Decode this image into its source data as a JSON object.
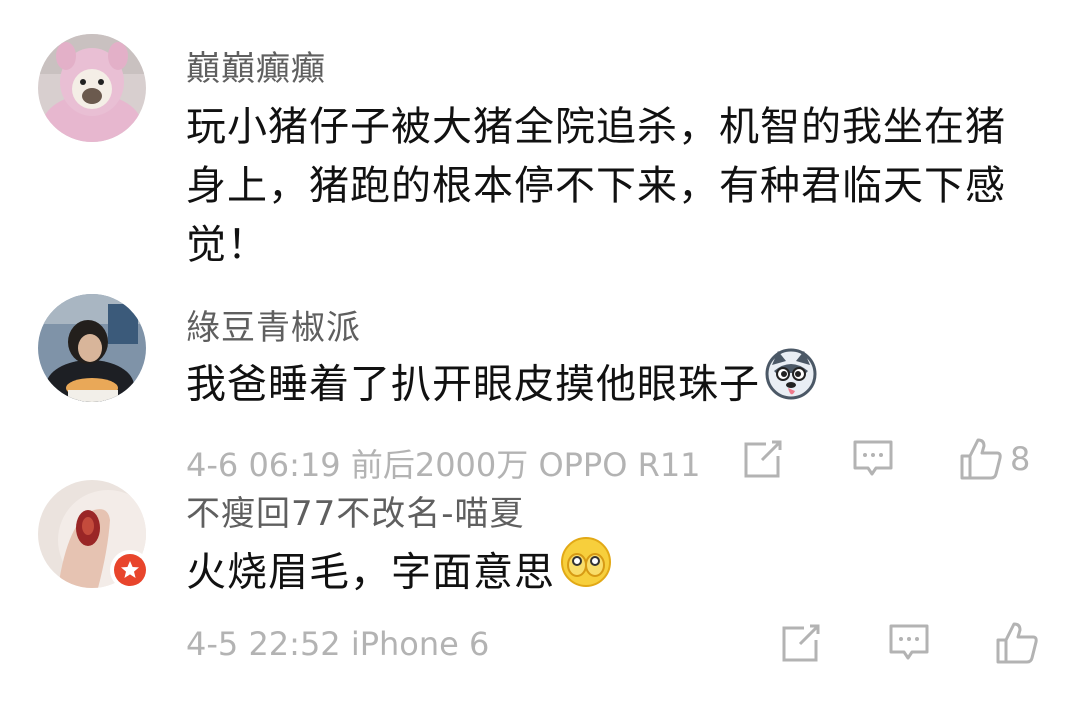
{
  "comments": [
    {
      "username": "巔巔癲癲",
      "text": "玩小猪仔子被大猪全院追杀，机智的我坐在猪身上，猪跑的根本停不下来，有种君临天下感觉！",
      "avatar": "dog-in-pink-hoodie",
      "meta": null
    },
    {
      "username": "綠豆青椒派",
      "text": "我爸睡着了扒开眼皮摸他眼珠子",
      "emoji": "husky-emoji",
      "avatar": "person-with-food",
      "meta": {
        "date": "4-6",
        "time": "06:19",
        "location": "前后2000万",
        "device": "OPPO R11",
        "likes": "8"
      }
    },
    {
      "username": "不瘦回77不改名-喵夏",
      "text": "火烧眉毛，字面意思",
      "emoji": "covering-face-emoji",
      "avatar": "hand-with-tattoo",
      "badge": "vip-star-badge",
      "meta": {
        "date": "4-5",
        "time": "22:52",
        "device": "iPhone 6",
        "likes": ""
      }
    }
  ],
  "meta_lines": [
    "4-6 06:19 前后2000万 OPPO R11",
    "4-5 22:52 iPhone 6"
  ],
  "colors": {
    "username": "#5f5f5f",
    "text": "#111111",
    "meta": "#b3b3b3",
    "badge": "#e8452c"
  }
}
